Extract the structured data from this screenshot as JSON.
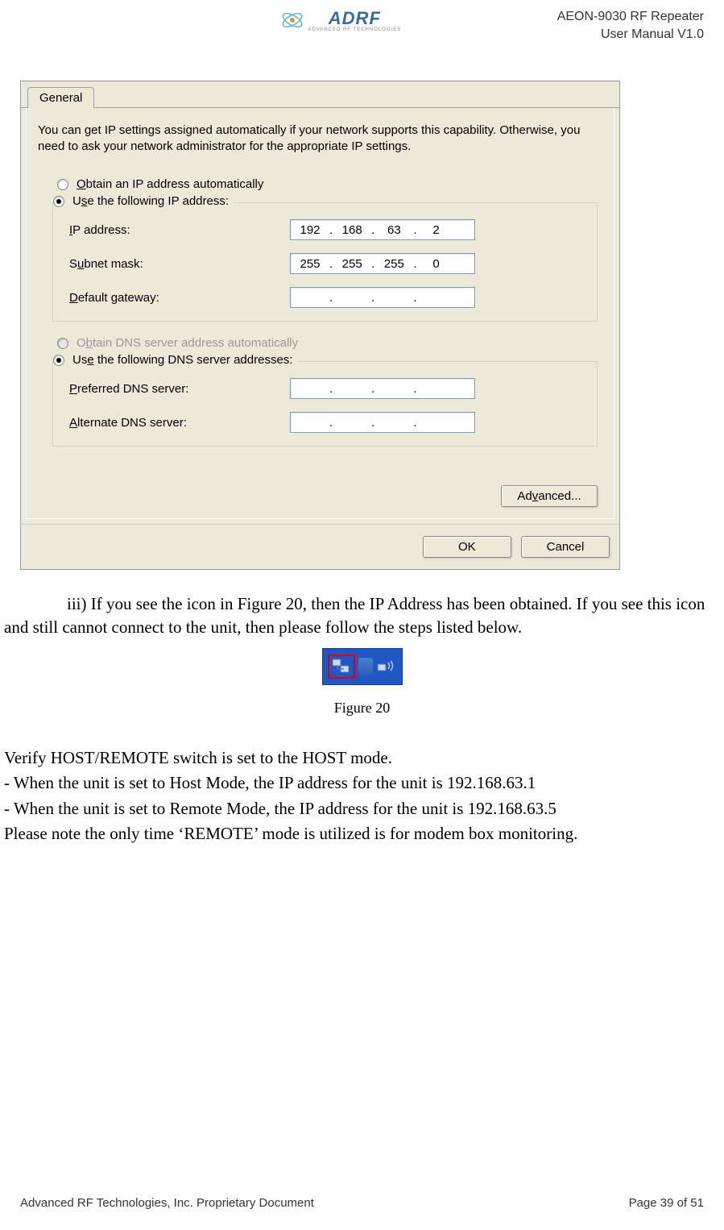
{
  "header": {
    "logo_text": "ADRF",
    "logo_sub": "ADVANCED RF TECHNOLOGIES",
    "right_line1": "AEON-9030 RF Repeater",
    "right_line2": "User Manual V1.0"
  },
  "dialog": {
    "tab": "General",
    "description": "You can get IP settings assigned automatically if your network supports this capability. Otherwise, you need to ask your network administrator for the appropriate IP settings.",
    "radio_obtain_ip": "Obtain an IP address automatically",
    "radio_use_ip": "Use the following IP address:",
    "ip_address_label": "IP address:",
    "ip_address": {
      "o1": "192",
      "o2": "168",
      "o3": "63",
      "o4": "2"
    },
    "subnet_label": "Subnet mask:",
    "subnet": {
      "o1": "255",
      "o2": "255",
      "o3": "255",
      "o4": "0"
    },
    "gateway_label": "Default gateway:",
    "gateway": {
      "o1": "",
      "o2": "",
      "o3": "",
      "o4": ""
    },
    "radio_obtain_dns": "Obtain DNS server address automatically",
    "radio_use_dns": "Use the following DNS server addresses:",
    "pref_dns_label": "Preferred DNS server:",
    "pref_dns": {
      "o1": "",
      "o2": "",
      "o3": "",
      "o4": ""
    },
    "alt_dns_label": "Alternate DNS server:",
    "alt_dns": {
      "o1": "",
      "o2": "",
      "o3": "",
      "o4": ""
    },
    "advanced": "Advanced...",
    "ok": "OK",
    "cancel": "Cancel"
  },
  "body": {
    "para1": "iii) If you see the icon in Figure 20, then the IP Address has been obtained. If you see this icon and still cannot connect to the unit, then please follow the steps listed below.",
    "figure_caption": "Figure 20",
    "line1": "Verify HOST/REMOTE switch is set to the HOST mode.",
    "line2": "- When the unit is set to Host Mode, the IP address for the unit is 192.168.63.1",
    "line3": "- When the unit is set to Remote Mode, the IP address for the unit is 192.168.63.5",
    "line4": "Please note the only time ‘REMOTE’ mode is utilized is for modem box monitoring."
  },
  "footer": {
    "left": "Advanced RF Technologies, Inc. Proprietary Document",
    "right": "Page 39 of 51"
  }
}
